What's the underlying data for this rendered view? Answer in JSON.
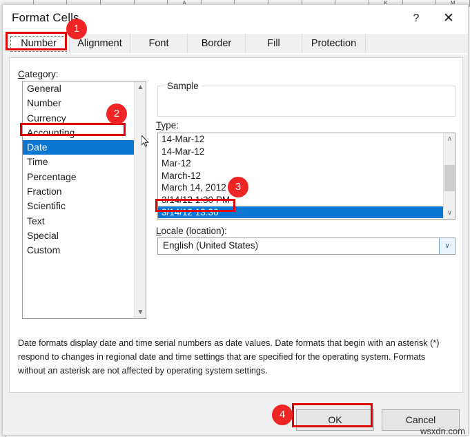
{
  "window": {
    "title": "Format Cells",
    "help_label": "?",
    "close_label": "✕"
  },
  "spreadsheet": {
    "column_headers": [
      "",
      "",
      "",
      "",
      "",
      "A",
      "",
      "",
      "",
      "",
      "",
      "K",
      "",
      "M"
    ]
  },
  "tabs": [
    {
      "label": "Number",
      "selected": true
    },
    {
      "label": "Alignment",
      "selected": false
    },
    {
      "label": "Font",
      "selected": false
    },
    {
      "label": "Border",
      "selected": false
    },
    {
      "label": "Fill",
      "selected": false
    },
    {
      "label": "Protection",
      "selected": false
    }
  ],
  "category": {
    "label": "Category:",
    "label_mnemonic": "C",
    "label_rest": "ategory:",
    "items": [
      "General",
      "Number",
      "Currency",
      "Accounting",
      "Date",
      "Time",
      "Percentage",
      "Fraction",
      "Scientific",
      "Text",
      "Special",
      "Custom"
    ],
    "selected": "Date",
    "selected_index": 4
  },
  "sample": {
    "legend": "Sample",
    "value": ""
  },
  "type": {
    "label": "Type:",
    "label_mnemonic": "T",
    "label_rest": "ype:",
    "items": [
      "14-Mar-12",
      "14-Mar-12",
      "Mar-12",
      "March-12",
      "March 14, 2012",
      "3/14/12 1:30 PM",
      "3/14/12 13:30"
    ],
    "selected": "3/14/12 13:30",
    "selected_index": 6,
    "scroll_up_glyph": "∧",
    "scroll_down_glyph": "∨"
  },
  "locale": {
    "label": "Locale (location):",
    "label_mnemonic": "L",
    "label_rest": "ocale (location):",
    "value": "English (United States)",
    "arrow_glyph": "∨"
  },
  "description": "Date formats display date and time serial numbers as date values.  Date formats that begin with an asterisk (*) respond to changes in regional date and time settings that are specified for the operating system. Formats without an asterisk are not affected by operating system settings.",
  "footer": {
    "ok_label": "OK",
    "cancel_label": "Cancel"
  },
  "annotations": {
    "badges": [
      "1",
      "2",
      "3",
      "4"
    ],
    "highlight_color": "#e00000",
    "badge_color": "#ef2424"
  },
  "watermark": "wsxdn.com",
  "colors": {
    "selection_blue": "#0a76d1",
    "dialog_face": "#f0f0f0",
    "panel_white": "#ffffff"
  }
}
